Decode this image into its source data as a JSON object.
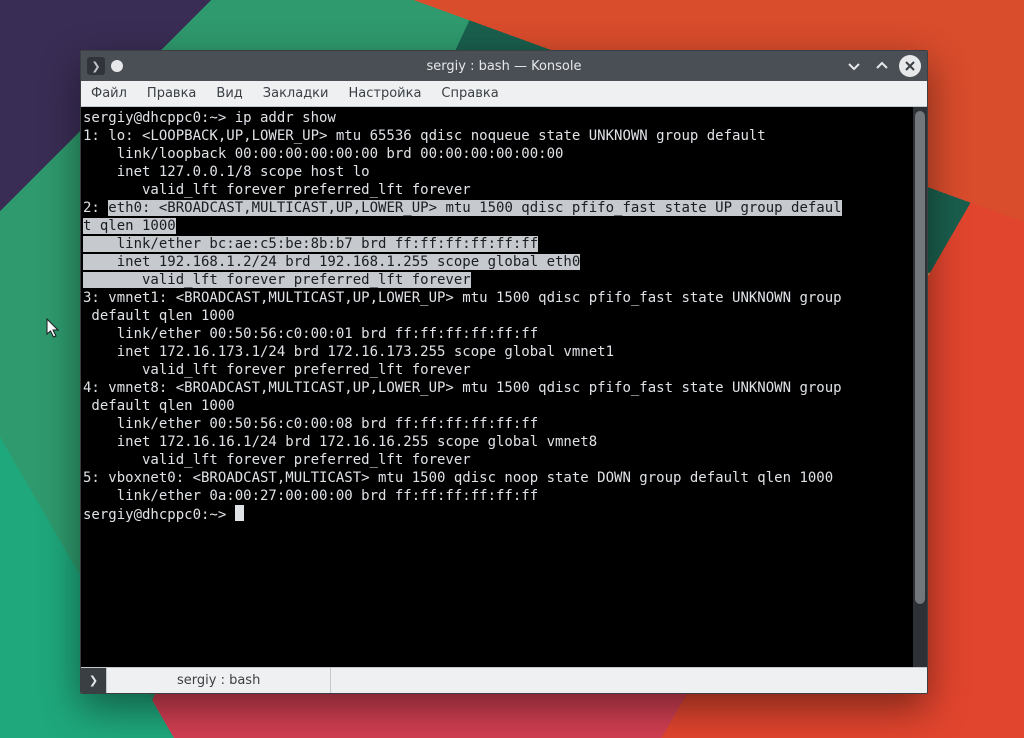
{
  "app": {
    "title": "sergiy : bash — Konsole"
  },
  "menu": {
    "file": "Файл",
    "edit": "Правка",
    "view": "Вид",
    "bookmarks": "Закладки",
    "settings": "Настройка",
    "help": "Справка"
  },
  "tabs": {
    "new_symbol": "❯",
    "active_label": "sergiy : bash"
  },
  "term": {
    "prompt1": "sergiy@dhcppc0:~> ",
    "cmd1": "ip addr show",
    "out": {
      "l1": "1: lo: <LOOPBACK,UP,LOWER_UP> mtu 65536 qdisc noqueue state UNKNOWN group default",
      "l2": "    link/loopback 00:00:00:00:00:00 brd 00:00:00:00:00:00",
      "l3": "    inet 127.0.0.1/8 scope host lo",
      "l4": "       valid_lft forever preferred_lft forever",
      "eth_pre": "2: ",
      "eth_a": "eth0: <BROADCAST,MULTICAST,UP,LOWER_UP> mtu 1500 qdisc pfifo_fast state UP group defaul",
      "eth_b": "t qlen 1000",
      "eth_c": "    link/ether bc:ae:c5:be:8b:b7 brd ff:ff:ff:ff:ff:ff",
      "eth_d": "    inet 192.168.1.2/24 brd 192.168.1.255 scope global eth0",
      "eth_e": "       valid_lft forever preferred_lft forever",
      "l10": "3: vmnet1: <BROADCAST,MULTICAST,UP,LOWER_UP> mtu 1500 qdisc pfifo_fast state UNKNOWN group",
      "l11": " default qlen 1000",
      "l12": "    link/ether 00:50:56:c0:00:01 brd ff:ff:ff:ff:ff:ff",
      "l13": "    inet 172.16.173.1/24 brd 172.16.173.255 scope global vmnet1",
      "l14": "       valid_lft forever preferred_lft forever",
      "l15": "4: vmnet8: <BROADCAST,MULTICAST,UP,LOWER_UP> mtu 1500 qdisc pfifo_fast state UNKNOWN group",
      "l16": " default qlen 1000",
      "l17": "    link/ether 00:50:56:c0:00:08 brd ff:ff:ff:ff:ff:ff",
      "l18": "    inet 172.16.16.1/24 brd 172.16.16.255 scope global vmnet8",
      "l19": "       valid_lft forever preferred_lft forever",
      "l20": "5: vboxnet0: <BROADCAST,MULTICAST> mtu 1500 qdisc noop state DOWN group default qlen 1000",
      "l21": "    link/ether 0a:00:27:00:00:00 brd ff:ff:ff:ff:ff:ff"
    },
    "prompt2": "sergiy@dhcppc0:~> "
  }
}
